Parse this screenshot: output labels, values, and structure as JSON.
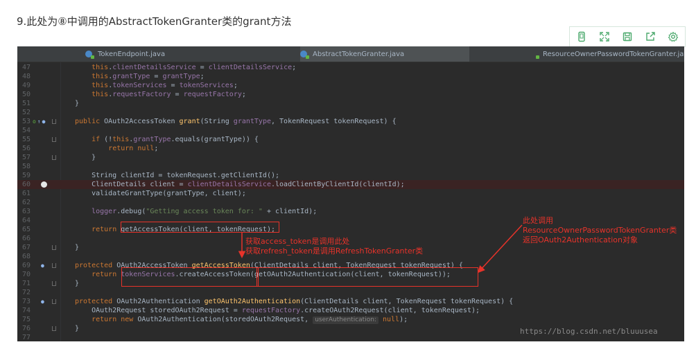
{
  "page": {
    "title": "9.此处为⑧中调用的AbstractTokenGranter类的grant方法"
  },
  "toolbar": {
    "buttons": [
      "phone-icon",
      "expand-icon",
      "save-icon",
      "share-icon",
      "settings-icon"
    ],
    "accent": "#4ba96c"
  },
  "ide": {
    "tabs": [
      {
        "label": "TokenEndpoint.java",
        "active": false
      },
      {
        "label": "AbstractTokenGranter.java",
        "active": true
      },
      {
        "label": "ResourceOwnerPasswordTokenGranter.java",
        "active": false
      }
    ],
    "lines": [
      {
        "n": "47",
        "code": "    this.clientDetailsService = clientDetailsService;"
      },
      {
        "n": "48",
        "code": "    this.grantType = grantType;"
      },
      {
        "n": "49",
        "code": "    this.tokenServices = tokenServices;"
      },
      {
        "n": "50",
        "code": "    this.requestFactory = requestFactory;"
      },
      {
        "n": "51",
        "code": "}"
      },
      {
        "n": "52",
        "code": ""
      },
      {
        "n": "53",
        "code": "public OAuth2AccessToken grant(String grantType, TokenRequest tokenRequest) {"
      },
      {
        "n": "54",
        "code": ""
      },
      {
        "n": "55",
        "code": "    if (!this.grantType.equals(grantType)) {"
      },
      {
        "n": "56",
        "code": "        return null;"
      },
      {
        "n": "57",
        "code": "    }"
      },
      {
        "n": "58",
        "code": ""
      },
      {
        "n": "59",
        "code": "    String clientId = tokenRequest.getClientId();"
      },
      {
        "n": "60",
        "code": "    ClientDetails client = clientDetailsService.loadClientByClientId(clientId);"
      },
      {
        "n": "61",
        "code": "    validateGrantType(grantType, client);"
      },
      {
        "n": "62",
        "code": ""
      },
      {
        "n": "63",
        "code": "    logger.debug(\"Getting access token for: \" + clientId);"
      },
      {
        "n": "64",
        "code": ""
      },
      {
        "n": "65",
        "code": "    return getAccessToken(client, tokenRequest);"
      },
      {
        "n": "66",
        "code": ""
      },
      {
        "n": "67",
        "code": "}"
      },
      {
        "n": "68",
        "code": ""
      },
      {
        "n": "69",
        "code": "protected OAuth2AccessToken getAccessToken(ClientDetails client, TokenRequest tokenRequest) {"
      },
      {
        "n": "70",
        "code": "    return tokenServices.createAccessToken(getOAuth2Authentication(client, tokenRequest));"
      },
      {
        "n": "71",
        "code": "}"
      },
      {
        "n": "72",
        "code": ""
      },
      {
        "n": "73",
        "code": "protected OAuth2Authentication getOAuth2Authentication(ClientDetails client, TokenRequest tokenRequest) {"
      },
      {
        "n": "74",
        "code": "    OAuth2Request storedOAuth2Request = requestFactory.createOAuth2Request(client, tokenRequest);"
      },
      {
        "n": "75",
        "code": "    return new OAuth2Authentication(storedOAuth2Request, "
      },
      {
        "n": "76",
        "code": "}"
      },
      {
        "n": "77",
        "code": ""
      }
    ],
    "inlay_hint": "userAuthentication:",
    "line75_tail": "null);",
    "breakpoint_line": "60",
    "colors": {
      "keyword": "#cc7832",
      "field": "#9876aa",
      "method": "#ffc66d",
      "string": "#6a8759",
      "default": "#a9b7c6",
      "annotation": "#e8332a"
    }
  },
  "annotations": {
    "left_note": [
      "获取access_token是调用此处",
      "获取refresh_token是调用RefreshTokenGranter类"
    ],
    "right_note": [
      "此处调用",
      "ResourceOwnerPasswordTokenGranter类",
      "返回OAuth2Authentication对象"
    ]
  },
  "watermark": "https://blog.csdn.net/bluuusea"
}
